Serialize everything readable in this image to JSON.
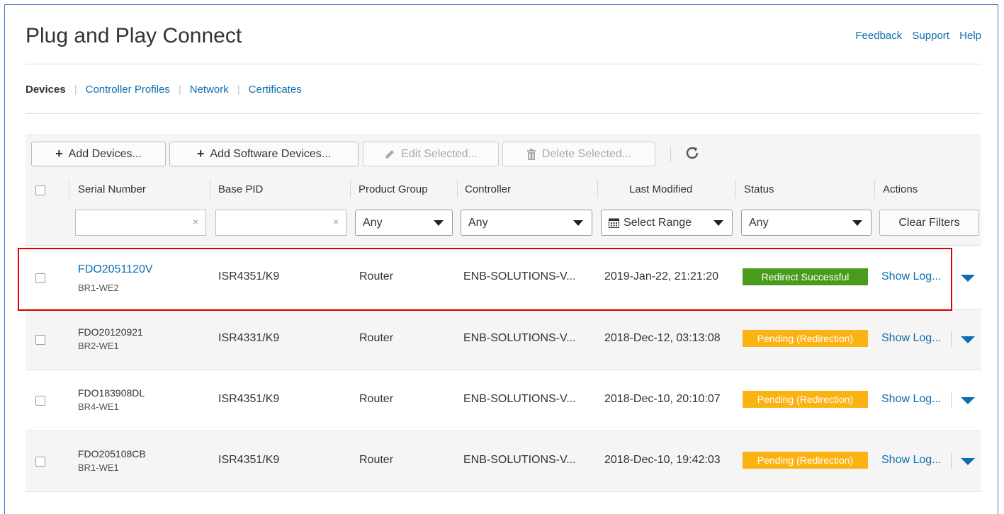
{
  "app": {
    "title": "Plug and Play Connect"
  },
  "top_links": [
    "Feedback",
    "Support",
    "Help"
  ],
  "tabs": [
    {
      "label": "Devices",
      "active": true
    },
    {
      "label": "Controller Profiles",
      "active": false
    },
    {
      "label": "Network",
      "active": false
    },
    {
      "label": "Certificates",
      "active": false
    }
  ],
  "toolbar": {
    "add_devices": "Add Devices...",
    "add_software_devices": "Add Software Devices...",
    "edit_selected": "Edit Selected...",
    "delete_selected": "Delete Selected..."
  },
  "columns": [
    "Serial Number",
    "Base PID",
    "Product Group",
    "Controller",
    "Last Modified",
    "Status",
    "Actions"
  ],
  "filters": {
    "clear_symbol": "×",
    "product_group": "Any",
    "controller": "Any",
    "last_modified": "Select Range",
    "status": "Any",
    "clear_filters": "Clear Filters"
  },
  "rows": [
    {
      "serial": "FDO2051120V",
      "name": "BR1-WE2",
      "pid": "ISR4351/K9",
      "group": "Router",
      "controller": "ENB-SOLUTIONS-V...",
      "modified": "2019-Jan-22, 21:21:20",
      "status": "Redirect Successful",
      "status_color": "#4a9b1c",
      "action": "Show Log..."
    },
    {
      "serial": "FDO20120921",
      "name": "BR2-WE1",
      "pid": "ISR4331/K9",
      "group": "Router",
      "controller": "ENB-SOLUTIONS-V...",
      "modified": "2018-Dec-12, 03:13:08",
      "status": "Pending (Redirection)",
      "status_color": "#fbb314",
      "action": "Show Log..."
    },
    {
      "serial": "FDO183908DL",
      "name": "BR4-WE1",
      "pid": "ISR4351/K9",
      "group": "Router",
      "controller": "ENB-SOLUTIONS-V...",
      "modified": "2018-Dec-10, 20:10:07",
      "status": "Pending (Redirection)",
      "status_color": "#fbb314",
      "action": "Show Log..."
    },
    {
      "serial": "FDO205108CB",
      "name": "BR1-WE1",
      "pid": "ISR4351/K9",
      "group": "Router",
      "controller": "ENB-SOLUTIONS-V...",
      "modified": "2018-Dec-10, 19:42:03",
      "status": "Pending (Redirection)",
      "status_color": "#fbb314",
      "action": "Show Log..."
    }
  ],
  "icons": {
    "plus": "plus-icon",
    "pencil": "pencil-icon",
    "trash": "trash-icon",
    "refresh": "refresh-icon",
    "calendar": "calendar-icon"
  },
  "colors": {
    "link": "#0d6eb0",
    "highlight_border": "#e00000"
  }
}
